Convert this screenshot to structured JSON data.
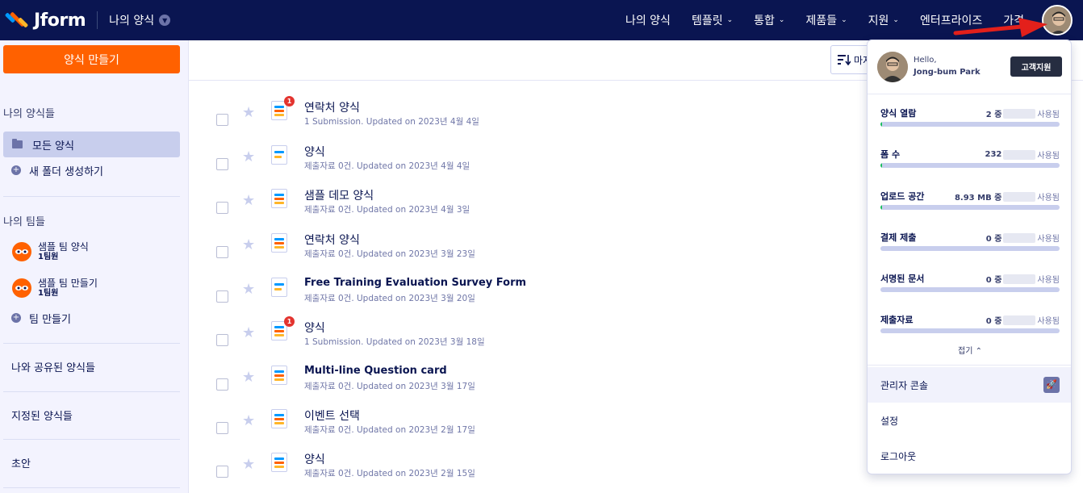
{
  "header": {
    "brand": "Jform",
    "my_forms_dropdown": "나의 양식",
    "nav": [
      {
        "label": "나의 양식",
        "caret": false
      },
      {
        "label": "템플릿",
        "caret": true
      },
      {
        "label": "통합",
        "caret": true
      },
      {
        "label": "제품들",
        "caret": true
      },
      {
        "label": "지원",
        "caret": true
      },
      {
        "label": "엔터프라이즈",
        "caret": false
      },
      {
        "label": "가격",
        "caret": false
      }
    ]
  },
  "sidebar": {
    "create_button": "양식 만들기",
    "my_forms_heading": "나의 양식들",
    "all_forms": "모든 양식",
    "new_folder": "새 폴더 생성하기",
    "my_teams_heading": "나의 팀들",
    "teams": [
      {
        "name": "샘플 팀 양식",
        "sub": "1팀원"
      },
      {
        "name": "샘플 팀 만들기",
        "sub": "1팀원"
      }
    ],
    "create_team": "팀 만들기",
    "shared_forms": "나와 공유된 양식들",
    "assigned_forms": "지정된 양식들",
    "drafts": "초안"
  },
  "toolbar": {
    "sort_label": "마지"
  },
  "forms": [
    {
      "title": "연락처 양식",
      "sub": "1 Submission. Updated on 2023년 4월 4일",
      "badge": "1",
      "bold": false,
      "icon": "form"
    },
    {
      "title": "양식",
      "sub": "제출자료 0건. Updated on 2023년 4월 4일",
      "badge": "",
      "bold": false,
      "icon": "card"
    },
    {
      "title": "샘플 데모 양식",
      "sub": "제출자료 0건. Updated on 2023년 4월 3일",
      "badge": "",
      "bold": false,
      "icon": "form"
    },
    {
      "title": "연락처 양식",
      "sub": "제출자료 0건. Updated on 2023년 3월 23일",
      "badge": "",
      "bold": false,
      "icon": "form"
    },
    {
      "title": "Free Training Evaluation Survey Form",
      "sub": "제출자료 0건. Updated on 2023년 3월 20일",
      "badge": "",
      "bold": true,
      "icon": "card"
    },
    {
      "title": "양식",
      "sub": "1 Submission. Updated on 2023년 3월 18일",
      "badge": "1",
      "bold": false,
      "icon": "form"
    },
    {
      "title": "Multi-line Question card",
      "sub": "제출자료 0건. Updated on 2023년 3월 17일",
      "badge": "",
      "bold": true,
      "icon": "form"
    },
    {
      "title": "이벤트 선택",
      "sub": "제출자료 0건. Updated on 2023년 2월 17일",
      "badge": "",
      "bold": false,
      "icon": "form"
    },
    {
      "title": "양식",
      "sub": "제출자료 0건. Updated on 2023년 2월 15일",
      "badge": "",
      "bold": false,
      "icon": "form"
    }
  ],
  "account_panel": {
    "hello": "Hello,",
    "user_name": "Jong-bum Park",
    "support_button": "고객지원",
    "usage": [
      {
        "label": "양식 열람",
        "value": "2 중",
        "unit": "사용됨",
        "fill_percent": 1
      },
      {
        "label": "폼 수",
        "value": "232",
        "unit": "사용됨",
        "fill_percent": 1
      },
      {
        "label": "업로드 공간",
        "value": "8.93 MB 중",
        "unit": "사용됨",
        "fill_percent": 1
      },
      {
        "label": "결제 제출",
        "value": "0 중",
        "unit": "사용됨",
        "fill_percent": 0
      },
      {
        "label": "서명된 문서",
        "value": "0 중",
        "unit": "사용됨",
        "fill_percent": 0
      },
      {
        "label": "제출자료",
        "value": "0 중",
        "unit": "사용됨",
        "fill_percent": 0
      }
    ],
    "collapse": "접기 ⌃",
    "admin_console": "관리자 콘솔",
    "settings": "설정",
    "logout": "로그아웃"
  },
  "colors": {
    "navbar": "#0a1551",
    "accent_orange": "#ff6100",
    "usage_fill": "#18bd5b",
    "annotation_arrow": "#e3201b"
  }
}
